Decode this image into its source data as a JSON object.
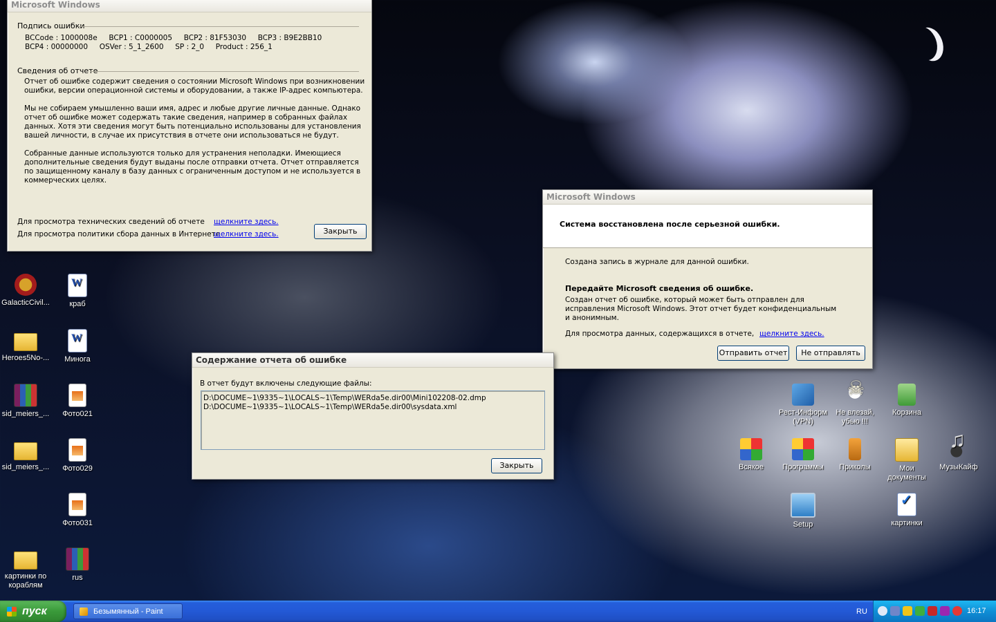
{
  "desktop": {
    "icons": [
      {
        "label": "GalacticCivil..."
      },
      {
        "label": "краб"
      },
      {
        "label": "Heroes5No-..."
      },
      {
        "label": "Минога"
      },
      {
        "label": "sid_meiers_..."
      },
      {
        "label": "Фото021"
      },
      {
        "label": "sid_meiers_..."
      },
      {
        "label": "Фото029"
      },
      {
        "label": "Фото031"
      },
      {
        "label": "картинки по кораблям"
      },
      {
        "label": "rus"
      },
      {
        "label": "Рест-Информ (VPN)"
      },
      {
        "label": "Не влезай, убью !!!"
      },
      {
        "label": "Корзина"
      },
      {
        "label": "Всякое"
      },
      {
        "label": "Программы"
      },
      {
        "label": "Приколы"
      },
      {
        "label": "Мои документы"
      },
      {
        "label": "МузыКайф"
      },
      {
        "label": "Setup"
      },
      {
        "label": "картинки"
      }
    ]
  },
  "details_window": {
    "title": "Microsoft Windows",
    "sig_header": "Подпись ошибки",
    "sig_line1": "BCCode : 1000008e     BCP1 : C0000005     BCP2 : 81F53030     BCP3 : B9E2BB10",
    "sig_line2": "BCP4 : 00000000     OSVer : 5_1_2600     SP : 2_0     Product : 256_1",
    "info_header": "Сведения об отчете",
    "para1": "Отчет об ошибке содержит сведения о состоянии Microsoft Windows при возникновении ошибки, версии операционной системы и оборудовании, а также IP-адрес компьютера.",
    "para2": "Мы не собираем умышленно ваши имя, адрес и любые другие личные данные. Однако отчет об ошибке может содержать такие сведения, например в собранных файлах данных. Хотя эти сведения могут быть потенциально использованы для установления вашей личности, в случае их присутствия в отчете они использоваться не будут.",
    "para3": "Собранные данные используются только для устранения неполадки. Имеющиеся дополнительные сведения будут выданы после отправки отчета. Отчет отправляется по защищенному каналу в базу данных с ограниченным доступом и не используется в коммерческих целях.",
    "tech_label": "Для просмотра технических сведений об отчете",
    "policy_label": "Для просмотра политики сбора данных в Интернете",
    "link_text": "щелкните здесь.",
    "close_button": "Закрыть"
  },
  "recovery_window": {
    "title": "Microsoft Windows",
    "heading": "Система восстановлена после серьезной ошибки.",
    "log_text": "Создана запись в журнале для данной ошибки.",
    "send_heading": "Передайте Microsoft сведения об ошибке.",
    "send_text": "Создан отчет об ошибке, который может быть отправлен для исправления Microsoft Windows. Этот отчет будет конфиденциальным и анонимным.",
    "view_label": "Для просмотра данных, содержащихся в отчете,",
    "link_text": "щелкните здесь.",
    "send_button": "Отправить отчет",
    "dont_send_button": "Не отправлять"
  },
  "contents_window": {
    "title": "Содержание отчета об ошибке",
    "intro": "В отчет будут включены следующие файлы:",
    "files": [
      "D:\\DOCUME~1\\9335~1\\LOCALS~1\\Temp\\WERda5e.dir00\\Mini102208-02.dmp",
      "D:\\DOCUME~1\\9335~1\\LOCALS~1\\Temp\\WERda5e.dir00\\sysdata.xml"
    ],
    "close_button": "Закрыть"
  },
  "taskbar": {
    "start_label": "пуск",
    "task_label": "Безымянный - Paint",
    "language": "RU",
    "clock": "16:17"
  }
}
